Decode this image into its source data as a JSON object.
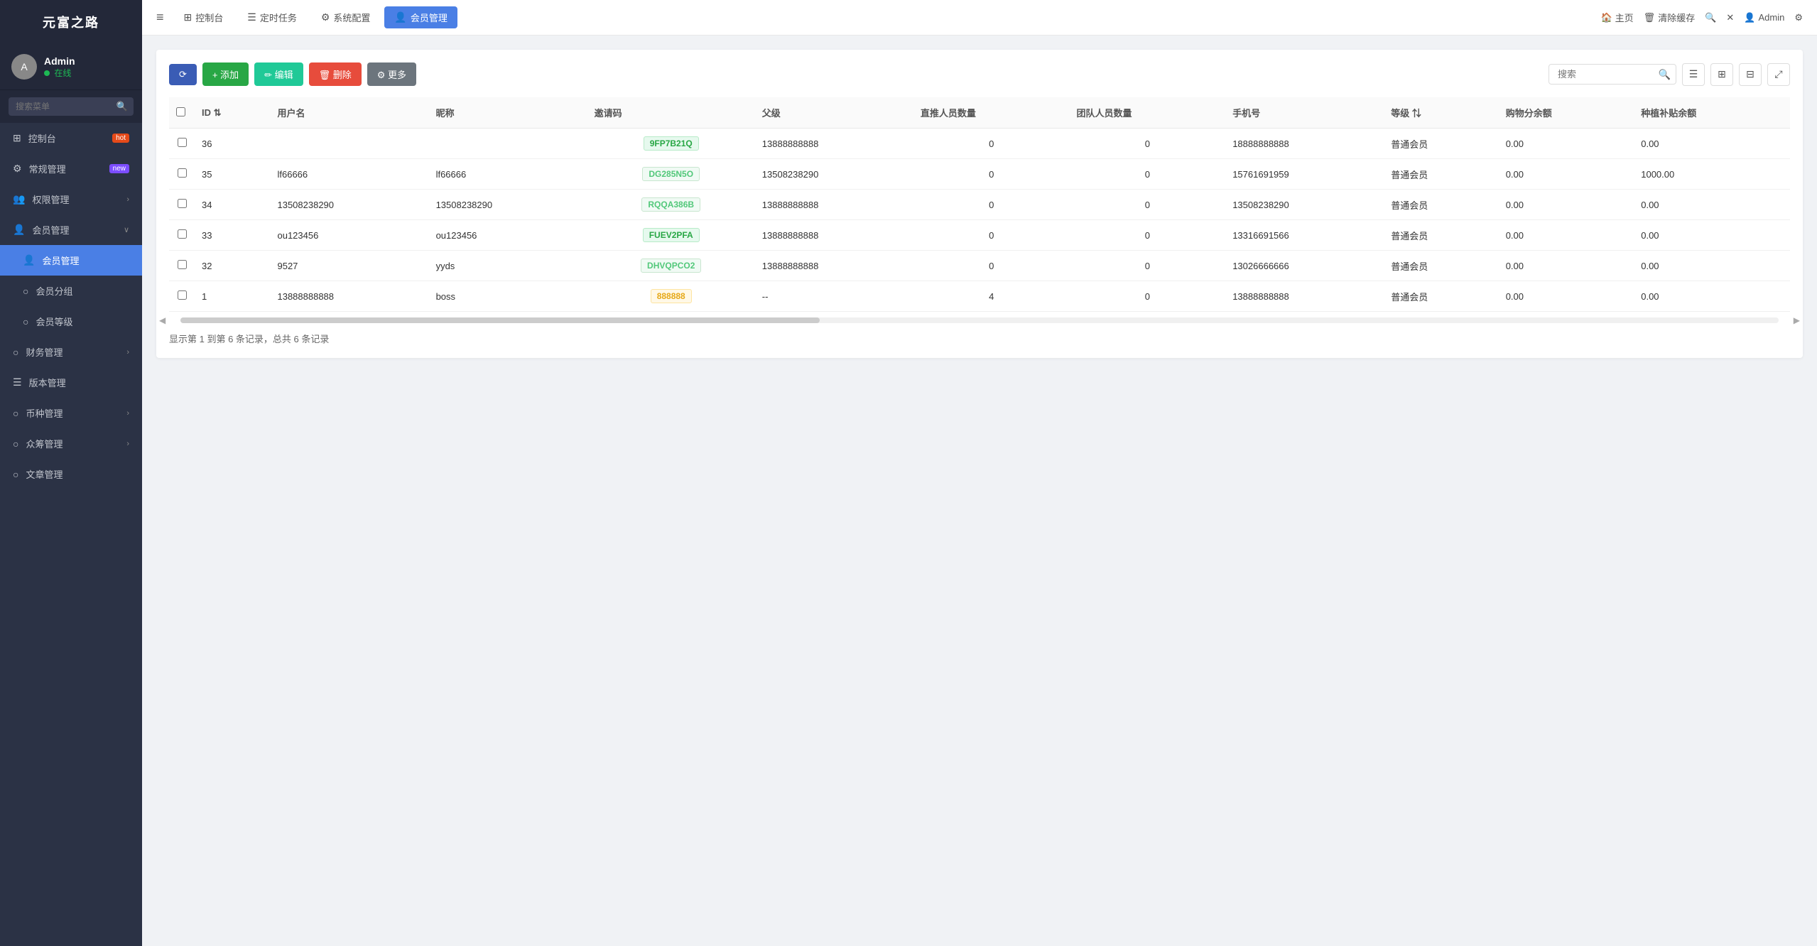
{
  "app": {
    "title": "元富之路"
  },
  "sidebar": {
    "user": {
      "name": "Admin",
      "status": "在线"
    },
    "search_placeholder": "搜索菜单",
    "items": [
      {
        "id": "dashboard",
        "label": "控制台",
        "icon": "⊞",
        "badge": "hot"
      },
      {
        "id": "general",
        "label": "常规管理",
        "icon": "⚙",
        "badge": "new"
      },
      {
        "id": "permission",
        "label": "权限管理",
        "icon": "👥",
        "arrow": true
      },
      {
        "id": "member",
        "label": "会员管理",
        "icon": "👤",
        "arrow": true,
        "expanded": true
      },
      {
        "id": "member-manage",
        "label": "会员管理",
        "icon": "👤",
        "active": true,
        "sub": true
      },
      {
        "id": "member-group",
        "label": "会员分组",
        "icon": "○",
        "sub": true
      },
      {
        "id": "member-level",
        "label": "会员等级",
        "icon": "○",
        "sub": true
      },
      {
        "id": "finance",
        "label": "财务管理",
        "icon": "○",
        "arrow": true
      },
      {
        "id": "version",
        "label": "版本管理",
        "icon": "☰"
      },
      {
        "id": "currency",
        "label": "币种管理",
        "icon": "○",
        "arrow": true
      },
      {
        "id": "crowdfunding",
        "label": "众筹管理",
        "icon": "○",
        "arrow": true
      },
      {
        "id": "article",
        "label": "文章管理",
        "icon": "○"
      }
    ]
  },
  "topbar": {
    "hamburger": "≡",
    "tabs": [
      {
        "id": "dashboard",
        "label": "控制台",
        "icon": "⊞"
      },
      {
        "id": "scheduled",
        "label": "定时任务",
        "icon": "☰"
      },
      {
        "id": "sysconfig",
        "label": "系统配置",
        "icon": "⚙"
      },
      {
        "id": "member",
        "label": "会员管理",
        "icon": "👤",
        "active": true
      }
    ],
    "right": [
      {
        "id": "home",
        "label": "主页",
        "icon": "🏠"
      },
      {
        "id": "clear-cache",
        "label": "清除缓存",
        "icon": "🗑"
      },
      {
        "id": "search",
        "label": "",
        "icon": "🔍"
      },
      {
        "id": "fullscreen",
        "label": "",
        "icon": "✕"
      },
      {
        "id": "admin",
        "label": "Admin",
        "icon": "👤"
      },
      {
        "id": "settings",
        "label": "",
        "icon": "⚙"
      }
    ]
  },
  "toolbar": {
    "refresh_label": "",
    "add_label": "+ 添加",
    "edit_label": "✏ 编辑",
    "delete_label": "🗑 删除",
    "more_label": "⚙ 更多",
    "search_placeholder": "搜索"
  },
  "table": {
    "columns": [
      "ID",
      "用户名",
      "昵称",
      "邀请码",
      "父级",
      "直推人员数量",
      "团队人员数量",
      "手机号",
      "等级",
      "购物分余额",
      "种植补贴余额"
    ],
    "rows": [
      {
        "id": "36",
        "username": "",
        "nickname": "",
        "invite_code": "9FP7B21Q",
        "invite_code_type": "green",
        "parent": "13888888888",
        "direct_count": "0",
        "team_count": "0",
        "phone": "18888888888",
        "level": "普通会员",
        "shopping_balance": "0.00",
        "plant_subsidy": "0.00"
      },
      {
        "id": "35",
        "username": "lf66666",
        "nickname": "lf66666",
        "invite_code": "DG285N5O",
        "invite_code_type": "light-green",
        "parent": "13508238290",
        "direct_count": "0",
        "team_count": "0",
        "phone": "15761691959",
        "level": "普通会员",
        "shopping_balance": "0.00",
        "plant_subsidy": "1000.00"
      },
      {
        "id": "34",
        "username": "13508238290",
        "nickname": "13508238290",
        "invite_code": "RQQA386B",
        "invite_code_type": "light-green",
        "parent": "13888888888",
        "direct_count": "0",
        "team_count": "0",
        "phone": "13508238290",
        "level": "普通会员",
        "shopping_balance": "0.00",
        "plant_subsidy": "0.00"
      },
      {
        "id": "33",
        "username": "ou123456",
        "nickname": "ou123456",
        "invite_code": "FUEV2PFA",
        "invite_code_type": "green",
        "parent": "13888888888",
        "direct_count": "0",
        "team_count": "0",
        "phone": "13316691566",
        "level": "普通会员",
        "shopping_balance": "0.00",
        "plant_subsidy": "0.00"
      },
      {
        "id": "32",
        "username": "9527",
        "nickname": "yyds",
        "invite_code": "DHVQPCO2",
        "invite_code_type": "light-green",
        "parent": "13888888888",
        "direct_count": "0",
        "team_count": "0",
        "phone": "13026666666",
        "level": "普通会员",
        "shopping_balance": "0.00",
        "plant_subsidy": "0.00"
      },
      {
        "id": "1",
        "username": "13888888888",
        "nickname": "boss",
        "invite_code": "888888",
        "invite_code_type": "orange",
        "parent": "--",
        "direct_count": "4",
        "team_count": "0",
        "phone": "13888888888",
        "level": "普通会员",
        "shopping_balance": "0.00",
        "plant_subsidy": "0.00"
      }
    ],
    "pagination_info": "显示第 1 到第 6 条记录，总共 6 条记录"
  }
}
